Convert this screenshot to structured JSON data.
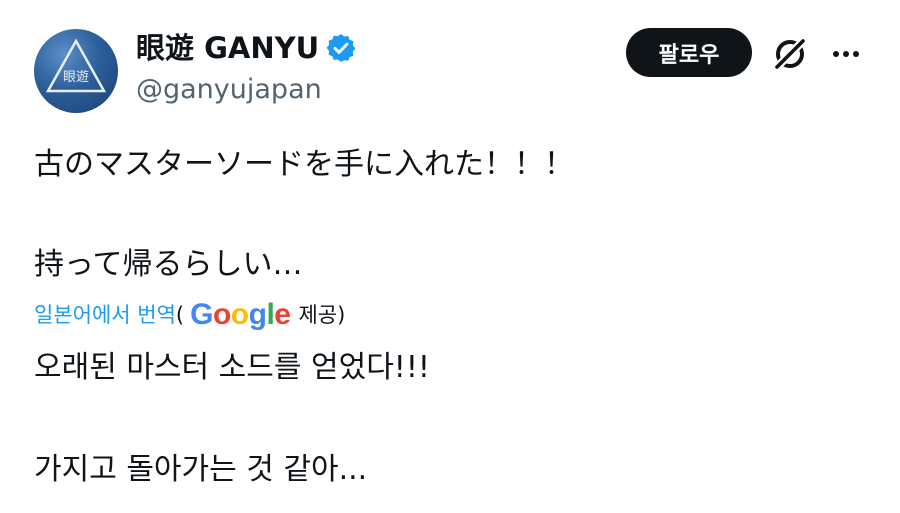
{
  "author": {
    "display_name": "眼遊 GANYU",
    "handle": "@ganyujapan",
    "avatar_text": "眼遊",
    "verified_color": "#1d9bf0"
  },
  "actions": {
    "follow_label": "팔로우",
    "grok_icon": "grok-icon",
    "more_icon": "more-icon"
  },
  "tweet": {
    "lines": [
      "古のマスターソードを手に入れた！！！",
      "持って帰るらしい…"
    ]
  },
  "translation": {
    "link_label": "일본어에서 번역",
    "open_paren": "(",
    "provider": "Google",
    "provided_label": "제공)",
    "lines": [
      "오래된 마스터 소드를 얻었다!!!",
      "가지고 돌아가는 것 같아..."
    ]
  },
  "colors": {
    "text": "#0f1419",
    "secondary": "#536471",
    "link": "#1d9bf0",
    "button_bg": "#0f1419"
  }
}
